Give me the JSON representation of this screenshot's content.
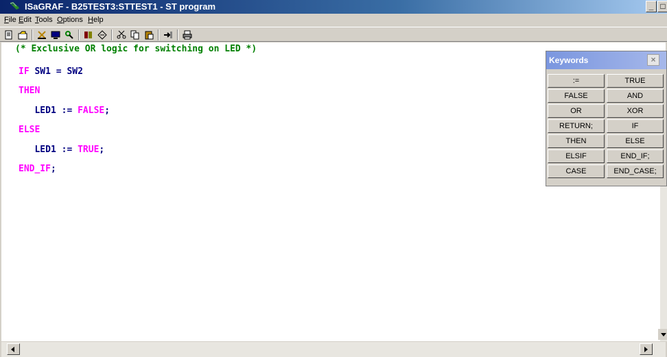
{
  "window": {
    "title": "ISaGRAF - B25TEST3:STTEST1 - ST program",
    "minimize": "_",
    "maximize": "□",
    "close": "×"
  },
  "menu": [
    "File",
    "Edit",
    "Tools",
    "Options",
    "Help"
  ],
  "menu_underline": [
    "F",
    "E",
    "T",
    "O",
    "H"
  ],
  "toolbar": {
    "icons": [
      "new-icon",
      "open-icon",
      "compile-icon",
      "monitor-icon",
      "debug-icon",
      "dictionary-icon",
      "variables-icon",
      "cut-icon",
      "copy-icon",
      "paste-icon",
      "goto-icon",
      "print-icon"
    ]
  },
  "code": [
    {
      "parts": [
        {
          "text": "(* Exclusive OR logic for switching on LED *)",
          "cls": "c-comment"
        }
      ]
    },
    {
      "parts": [
        {
          "text": "IF",
          "cls": "c-kw"
        },
        {
          "text": " SW1 = SW2",
          "cls": "c-text"
        }
      ]
    },
    {
      "parts": [
        {
          "text": "THEN",
          "cls": "c-kw"
        }
      ]
    },
    {
      "parts": [
        {
          "text": "   LED1 := ",
          "cls": "c-text"
        },
        {
          "text": "FALSE",
          "cls": "c-kw"
        },
        {
          "text": ";",
          "cls": "c-text"
        }
      ]
    },
    {
      "parts": [
        {
          "text": "ELSE",
          "cls": "c-kw"
        }
      ]
    },
    {
      "parts": [
        {
          "text": "   LED1 := ",
          "cls": "c-text"
        },
        {
          "text": "TRUE",
          "cls": "c-kw"
        },
        {
          "text": ";",
          "cls": "c-text"
        }
      ]
    },
    {
      "parts": [
        {
          "text": "END_IF",
          "cls": "c-kw"
        },
        {
          "text": ";",
          "cls": "c-text"
        }
      ]
    }
  ],
  "keywords_panel": {
    "title": "Keywords",
    "close": "×",
    "buttons": [
      ":=",
      "TRUE",
      "FALSE",
      "AND",
      "OR",
      "XOR",
      "RETURN;",
      "IF",
      "THEN",
      "ELSE",
      "ELSIF",
      "END_IF;",
      "CASE",
      "END_CASE;"
    ]
  },
  "colors": {
    "comment": "#008000",
    "keyword": "#ff00ff",
    "identifier": "#000080",
    "titlebar": "#0a246a"
  }
}
